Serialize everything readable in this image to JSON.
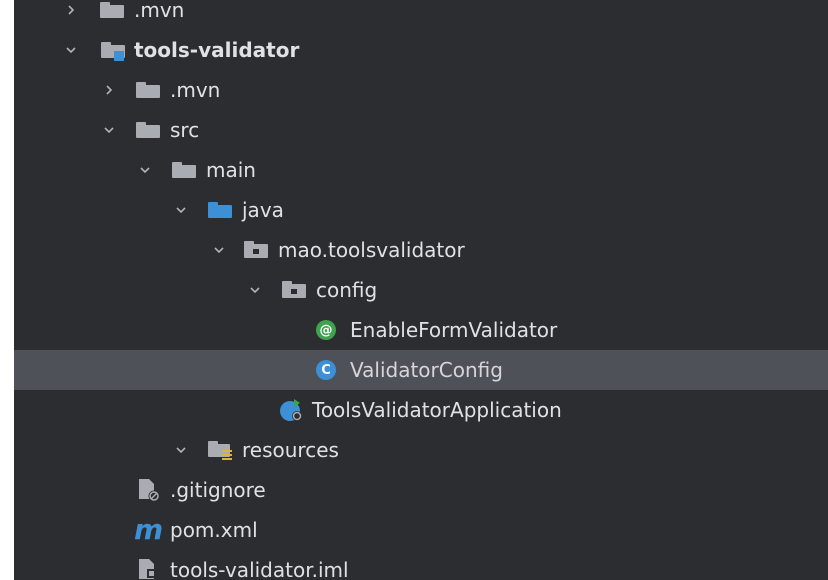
{
  "tree": {
    "items": [
      {
        "label": ".mvn"
      },
      {
        "label": "tools-validator"
      },
      {
        "label": ".mvn"
      },
      {
        "label": "src"
      },
      {
        "label": "main"
      },
      {
        "label": "java"
      },
      {
        "label": "mao.toolsvalidator"
      },
      {
        "label": "config"
      },
      {
        "label": "EnableFormValidator"
      },
      {
        "label": "ValidatorConfig"
      },
      {
        "label": "ToolsValidatorApplication"
      },
      {
        "label": "resources"
      },
      {
        "label": ".gitignore"
      },
      {
        "label": "pom.xml"
      },
      {
        "label": "tools-validator.iml"
      }
    ]
  },
  "icons": {
    "annotation_glyph": "@",
    "class_glyph": "C",
    "maven_glyph": "m"
  },
  "colors": {
    "background": "#2b2d30",
    "selected_row": "#4e5157",
    "folder": "#a9adb3",
    "source_folder": "#3d8fd6",
    "annotation_icon": "#3fa34d",
    "class_icon": "#3d8fd6",
    "maven_icon": "#3d8fd6"
  }
}
